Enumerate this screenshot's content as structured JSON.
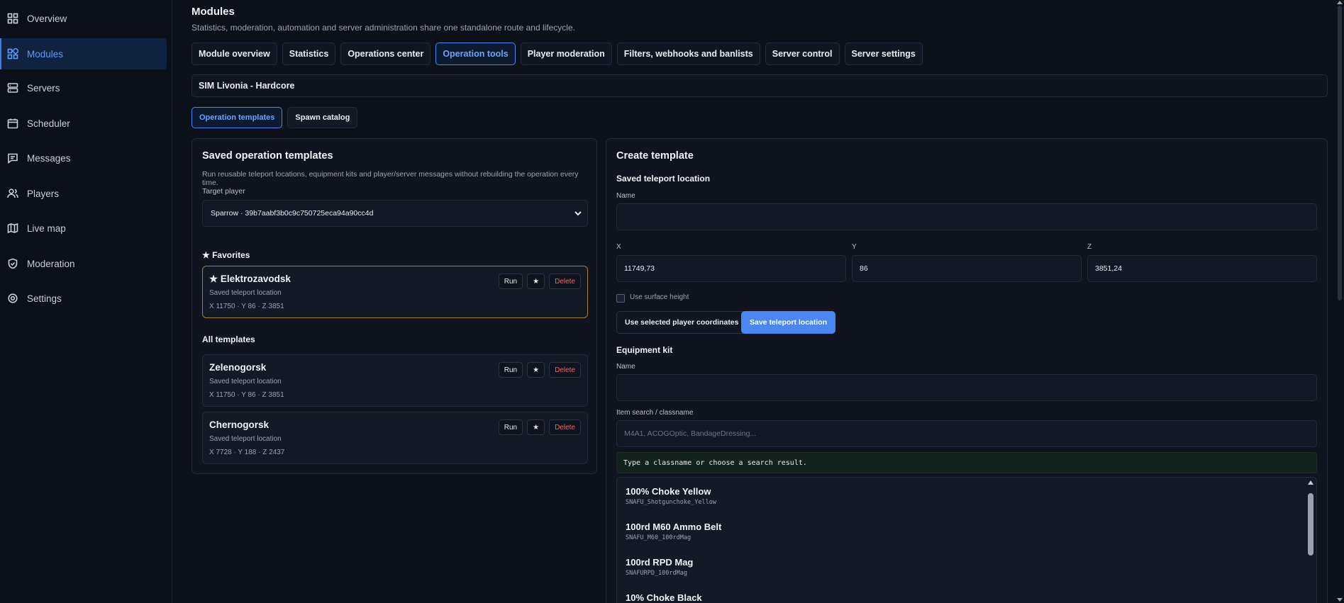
{
  "sidebar": {
    "items": [
      {
        "label": "Overview",
        "icon": "grid-icon"
      },
      {
        "label": "Modules",
        "icon": "modules-icon"
      },
      {
        "label": "Servers",
        "icon": "server-icon"
      },
      {
        "label": "Scheduler",
        "icon": "calendar-icon"
      },
      {
        "label": "Messages",
        "icon": "message-icon"
      },
      {
        "label": "Players",
        "icon": "users-icon"
      },
      {
        "label": "Live map",
        "icon": "map-icon"
      },
      {
        "label": "Moderation",
        "icon": "shield-icon"
      },
      {
        "label": "Settings",
        "icon": "gear-icon"
      }
    ],
    "active": "Modules"
  },
  "page": {
    "title": "Modules",
    "subtitle": "Statistics, moderation, automation and server administration share one standalone route and lifecycle."
  },
  "tabs": [
    {
      "label": "Module overview"
    },
    {
      "label": "Statistics"
    },
    {
      "label": "Operations center"
    },
    {
      "label": "Operation tools"
    },
    {
      "label": "Player moderation"
    },
    {
      "label": "Filters, webhooks and banlists"
    },
    {
      "label": "Server control"
    },
    {
      "label": "Server settings"
    }
  ],
  "active_tab": "Operation tools",
  "server": {
    "name": "SIM Livonia - Hardcore"
  },
  "subtabs": [
    {
      "label": "Operation templates"
    },
    {
      "label": "Spawn catalog"
    }
  ],
  "left": {
    "title": "Saved operation templates",
    "description": "Run reusable teleport locations, equipment kits and player/server messages without rebuilding the operation every time.",
    "target_label": "Target player",
    "target_value": "Sparrow · 39b7aabf3b0c9c750725eca94a90cc4d",
    "favorites_heading": "★ Favorites",
    "all_heading": "All templates",
    "run_label": "Run",
    "star_label": "★",
    "delete_label": "Delete",
    "favorites": [
      {
        "name": "★ Elektrozavodsk",
        "type": "Saved teleport location",
        "coords": "X 11750 · Y 86 · Z 3851"
      }
    ],
    "templates": [
      {
        "name": "Zelenogorsk",
        "type": "Saved teleport location",
        "coords": "X 11750 · Y 86 · Z 3851"
      },
      {
        "name": "Chernogorsk",
        "type": "Saved teleport location",
        "coords": "X 7728 · Y 188 · Z 2437"
      }
    ]
  },
  "right": {
    "title": "Create template",
    "teleport_heading": "Saved teleport location",
    "name_label": "Name",
    "name_value": "",
    "x_label": "X",
    "x_value": "11749,73",
    "y_label": "Y",
    "y_value": "86",
    "z_label": "Z",
    "z_value": "3851,24",
    "surface_label": "Use surface height",
    "use_coords_button": "Use selected player coordinates",
    "save_button": "Save teleport location",
    "kit_heading": "Equipment kit",
    "kit_name_label": "Name",
    "kit_name_value": "",
    "search_label": "Item search / classname",
    "search_placeholder": "M4A1, ACOGOptic, BandageDressing...",
    "hint": "Type a classname or choose a search result.",
    "results": [
      {
        "name": "100% Choke Yellow",
        "classname": "SNAFU_Shotgunchoke_Yellow"
      },
      {
        "name": "100rd M60 Ammo Belt",
        "classname": "SNAFU_M60_100rdMag"
      },
      {
        "name": "100rd RPD Mag",
        "classname": "SNAFURPD_100rdMag"
      },
      {
        "name": "10% Choke Black",
        "classname": ""
      }
    ]
  },
  "colors": {
    "accent": "#4b86f2",
    "favorite_border": "#a7822a",
    "delete": "#f06464",
    "background": "#0b1019"
  }
}
